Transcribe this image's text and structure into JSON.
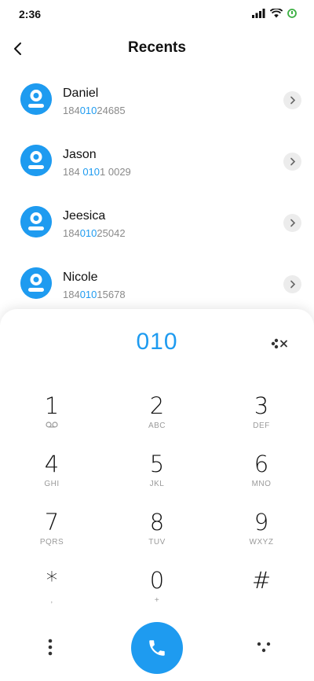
{
  "status": {
    "time": "2:36"
  },
  "header": {
    "title": "Recents"
  },
  "contacts": [
    {
      "name": "Daniel",
      "number_pre": "184",
      "number_match": "010",
      "number_post": "24685"
    },
    {
      "name": "Jason",
      "number_pre": "184 ",
      "number_match": "010",
      "number_post": "1 0029"
    },
    {
      "name": "Jeesica",
      "number_pre": "184",
      "number_match": "010",
      "number_post": "25042"
    },
    {
      "name": "Nicole",
      "number_pre": "184",
      "number_match": "010",
      "number_post": "15678"
    }
  ],
  "dialer": {
    "number": "010",
    "keys": [
      {
        "digit": "1",
        "letters": ""
      },
      {
        "digit": "2",
        "letters": "ABC"
      },
      {
        "digit": "3",
        "letters": "DEF"
      },
      {
        "digit": "4",
        "letters": "GHI"
      },
      {
        "digit": "5",
        "letters": "JKL"
      },
      {
        "digit": "6",
        "letters": "MNO"
      },
      {
        "digit": "7",
        "letters": "PQRS"
      },
      {
        "digit": "8",
        "letters": "TUV"
      },
      {
        "digit": "9",
        "letters": "WXYZ"
      },
      {
        "digit": "*",
        "letters": ","
      },
      {
        "digit": "0",
        "letters": "+"
      },
      {
        "digit": "#",
        "letters": ""
      }
    ]
  },
  "icons": {
    "back": "back-arrow-icon",
    "call": "phone-icon",
    "voicemail": "voicemail-icon",
    "clear": "backspace-icon",
    "menu": "more-vertical-icon",
    "hide": "dialpad-icon"
  },
  "colors": {
    "accent": "#1e9bf0",
    "secondary_text": "#8a8a8a"
  }
}
